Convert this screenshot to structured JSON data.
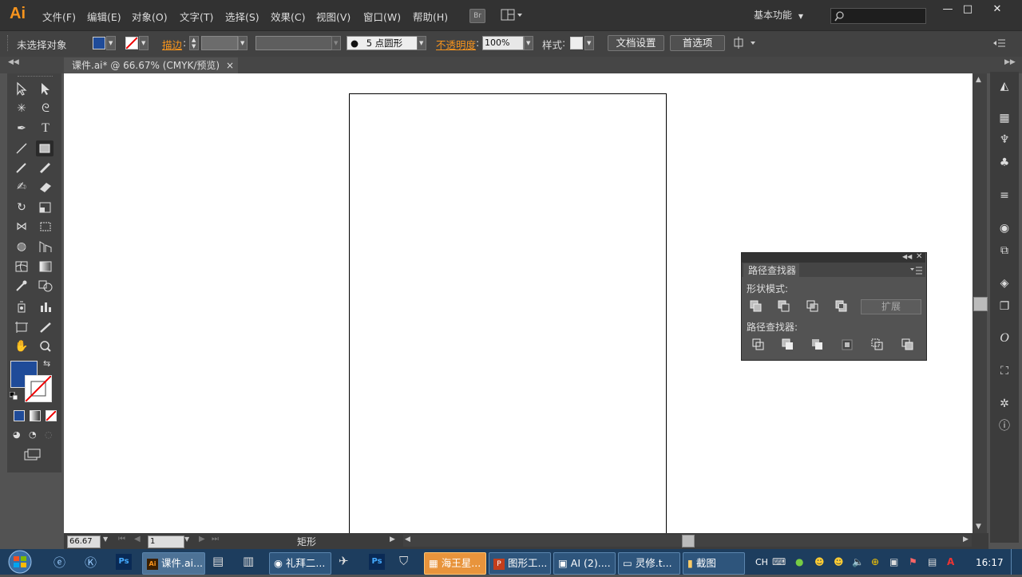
{
  "app": {
    "logo": "Ai",
    "bridge": "Br"
  },
  "menu": [
    "文件(F)",
    "编辑(E)",
    "对象(O)",
    "文字(T)",
    "选择(S)",
    "效果(C)",
    "视图(V)",
    "窗口(W)",
    "帮助(H)"
  ],
  "workspace": "基本功能",
  "window_buttons": {
    "minimize": "—",
    "maximize": "□",
    "close": "✕"
  },
  "control": {
    "selection": "未选择对象",
    "stroke_label": "描边",
    "brush": "5 点圆形",
    "opacity_label": "不透明度",
    "opacity_value": "100%",
    "style_label": "样式",
    "doc_setup": "文档设置",
    "preferences": "首选项"
  },
  "document_tab": {
    "title": "课件.ai* @ 66.67% (CMYK/预览)",
    "close": "×"
  },
  "status": {
    "zoom": "66.67",
    "page": "1",
    "tool": "矩形"
  },
  "pathfinder": {
    "title": "路径查找器",
    "shape_modes": "形状模式:",
    "expand": "扩展",
    "pathfinders": "路径查找器:"
  },
  "taskbar": {
    "items": [
      "课件.ai...",
      "礼拜二...",
      "海王星...",
      "图形工...",
      "AI (2)....",
      "灵修.t...",
      "截图"
    ],
    "lang": "CH",
    "clock": "16:17"
  },
  "colors": {
    "fill": "#1f4b99",
    "accent": "#f7941d"
  }
}
